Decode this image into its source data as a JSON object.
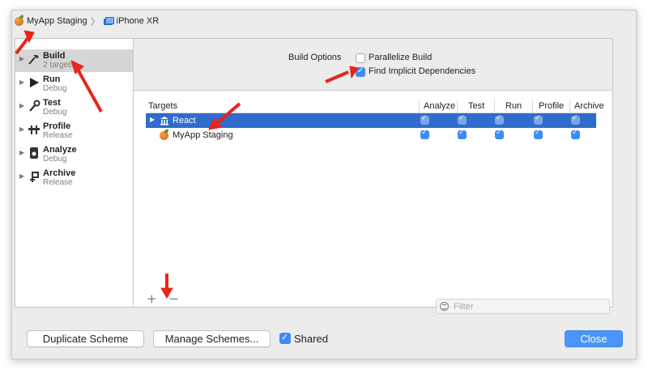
{
  "breadcrumb": {
    "scheme": "MyApp Staging",
    "separator": "〉",
    "device": "iPhone XR"
  },
  "sidebar": {
    "items": [
      {
        "title": "Build",
        "subtitle": "2 targets",
        "icon": "hammer-icon",
        "selected": true
      },
      {
        "title": "Run",
        "subtitle": "Debug",
        "icon": "play-icon"
      },
      {
        "title": "Test",
        "subtitle": "Debug",
        "icon": "wrench-icon"
      },
      {
        "title": "Profile",
        "subtitle": "Release",
        "icon": "instruments-icon"
      },
      {
        "title": "Analyze",
        "subtitle": "Debug",
        "icon": "analyze-icon"
      },
      {
        "title": "Archive",
        "subtitle": "Release",
        "icon": "archive-icon"
      }
    ]
  },
  "build_options": {
    "label": "Build Options",
    "parallelize": {
      "label": "Parallelize Build",
      "checked": false
    },
    "implicit": {
      "label": "Find Implicit Dependencies",
      "checked": true
    }
  },
  "targets": {
    "headers": [
      "Targets",
      "Analyze",
      "Test",
      "Run",
      "Profile",
      "Archive"
    ],
    "rows": [
      {
        "name": "React",
        "icon": "library-icon",
        "selected": true,
        "expandable": true,
        "checks": [
          true,
          true,
          true,
          true,
          true
        ]
      },
      {
        "name": "MyApp Staging",
        "icon": "app-icon",
        "selected": false,
        "expandable": false,
        "checks": [
          true,
          true,
          true,
          true,
          true
        ]
      }
    ]
  },
  "list_controls": {
    "add": "+",
    "remove": "−"
  },
  "filter": {
    "placeholder": "Filter"
  },
  "footer": {
    "duplicate": "Duplicate Scheme",
    "manage": "Manage Schemes...",
    "shared": "Shared",
    "shared_checked": true,
    "close": "Close"
  },
  "colors": {
    "accent": "#3d8cf6",
    "selection": "#2f6ccb",
    "annotation": "#e8241b"
  }
}
